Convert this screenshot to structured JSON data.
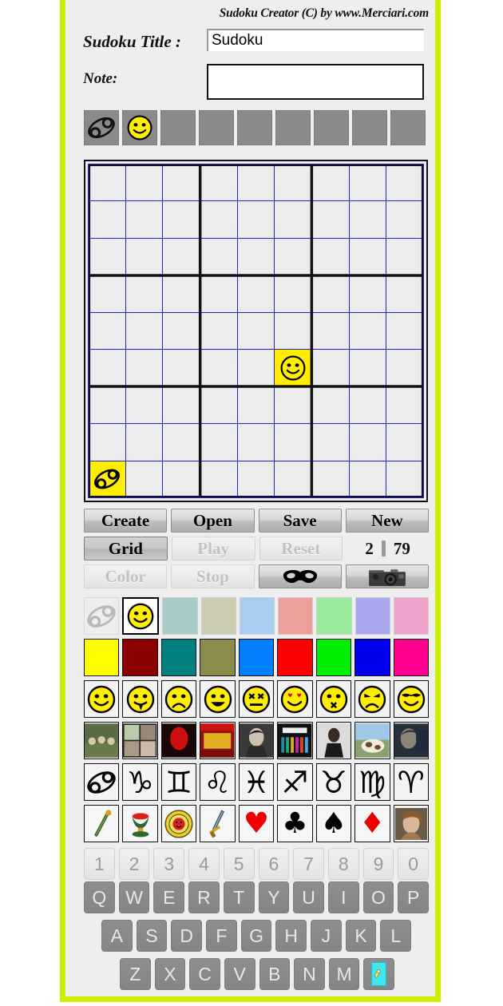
{
  "app": {
    "brand": "Sudoku Creator (C) by www.Merciari.com",
    "border_color": "#cdee00",
    "background": "#eeeeee"
  },
  "form": {
    "title_label": "Sudoku Title :",
    "title_value": "Sudoku",
    "title_placeholder": "",
    "note_label": "Note:",
    "note_value": "",
    "note_placeholder": ""
  },
  "slots": {
    "count": 9,
    "items": [
      {
        "name": "slot-cancer",
        "icon": "cancer-zodiac-icon",
        "filled": true
      },
      {
        "name": "slot-smiley",
        "icon": "smiley-happy-icon",
        "filled": true
      },
      {
        "name": "slot-3",
        "icon": "empty",
        "filled": false
      },
      {
        "name": "slot-4",
        "icon": "empty",
        "filled": false
      },
      {
        "name": "slot-5",
        "icon": "empty",
        "filled": false
      },
      {
        "name": "slot-6",
        "icon": "empty",
        "filled": false
      },
      {
        "name": "slot-7",
        "icon": "empty",
        "filled": false
      },
      {
        "name": "slot-8",
        "icon": "empty",
        "filled": false
      },
      {
        "name": "slot-9",
        "icon": "empty",
        "filled": false
      }
    ]
  },
  "grid": {
    "size": 9,
    "cell_background": "#ececec",
    "filled_background": "#ffee00",
    "thin_line_color": "#2222cc",
    "thick_line_color": "#111111",
    "filled_cells": [
      {
        "row": 6,
        "col": 6,
        "icon": "smiley-happy-icon"
      },
      {
        "row": 9,
        "col": 1,
        "icon": "cancer-zodiac-icon"
      }
    ]
  },
  "buttons": {
    "row_a": [
      {
        "label": "Create",
        "state": "normal",
        "name": "create-button"
      },
      {
        "label": "Open",
        "state": "normal",
        "name": "open-button"
      },
      {
        "label": "Save",
        "state": "normal",
        "name": "save-button"
      },
      {
        "label": "New",
        "state": "normal",
        "name": "new-button"
      }
    ],
    "row_b": [
      {
        "label": "Grid",
        "state": "pressed",
        "name": "grid-button"
      },
      {
        "label": "Play",
        "state": "disabled",
        "name": "play-button"
      },
      {
        "label": "Reset",
        "state": "disabled",
        "name": "reset-button"
      }
    ],
    "row_c": [
      {
        "label": "Color",
        "state": "disabled",
        "name": "color-button"
      },
      {
        "label": "Stop",
        "state": "disabled",
        "name": "stop-button"
      },
      {
        "label": "",
        "state": "normal",
        "name": "mask-button",
        "icon": "mask-icon"
      },
      {
        "label": "",
        "state": "normal",
        "name": "camera-button",
        "icon": "camera-icon"
      }
    ],
    "counter": {
      "filled": "2",
      "remaining": "79"
    }
  },
  "palettes": {
    "pastel": {
      "name": "pastel-color-row",
      "cells": [
        {
          "kind": "icon",
          "icon": "cancer-zodiac-icon",
          "state": "faded",
          "color": "#eeeeee"
        },
        {
          "kind": "icon",
          "icon": "smiley-happy-icon",
          "state": "selected",
          "color": "#ffffff"
        },
        {
          "kind": "color",
          "color": "#a8cccb"
        },
        {
          "kind": "color",
          "color": "#ccccb0"
        },
        {
          "kind": "color",
          "color": "#a7cdf0"
        },
        {
          "kind": "color",
          "color": "#ef9f9b"
        },
        {
          "kind": "color",
          "color": "#9ceb9a"
        },
        {
          "kind": "color",
          "color": "#a8a8f0"
        },
        {
          "kind": "color",
          "color": "#efa3cb"
        }
      ]
    },
    "bold": {
      "name": "bold-color-row",
      "cells": [
        {
          "kind": "color",
          "color": "#ffff00"
        },
        {
          "kind": "color",
          "color": "#8b0000"
        },
        {
          "kind": "color",
          "color": "#008080"
        },
        {
          "kind": "color",
          "color": "#8b8b4b"
        },
        {
          "kind": "color",
          "color": "#0080ff"
        },
        {
          "kind": "color",
          "color": "#ff0000"
        },
        {
          "kind": "color",
          "color": "#00ee00"
        },
        {
          "kind": "color",
          "color": "#0000ee"
        },
        {
          "kind": "color",
          "color": "#ff0090"
        }
      ]
    },
    "smileys": {
      "name": "smiley-row",
      "cells": [
        {
          "icon": "smiley-happy-icon"
        },
        {
          "icon": "smiley-tongue-icon"
        },
        {
          "icon": "smiley-sad-icon"
        },
        {
          "icon": "smiley-laugh-icon"
        },
        {
          "icon": "smiley-dead-icon"
        },
        {
          "icon": "smiley-love-icon"
        },
        {
          "icon": "smiley-kiss-icon"
        },
        {
          "icon": "smiley-angry-icon"
        },
        {
          "icon": "smiley-cool-icon"
        }
      ]
    },
    "albums": {
      "name": "album-cover-row",
      "cells": [
        {
          "icon": "album-band-photo-icon",
          "color": "#5b6b4a"
        },
        {
          "icon": "album-portraits-icon",
          "color": "#2a2a2a"
        },
        {
          "icon": "album-red-face-icon",
          "color": "#1a0606"
        },
        {
          "icon": "album-doors-icon",
          "color": "#8e1010"
        },
        {
          "icon": "album-elvis-icon",
          "color": "#3a3a3a"
        },
        {
          "icon": "album-beatles-icon",
          "color": "#101010"
        },
        {
          "icon": "album-michael-icon",
          "color": "#d8d8d8"
        },
        {
          "icon": "album-cow-icon",
          "color": "#89a26e"
        },
        {
          "icon": "album-dylan-icon",
          "color": "#26303c"
        }
      ]
    },
    "zodiac": {
      "name": "zodiac-row",
      "cells": [
        {
          "icon": "cancer-zodiac-icon",
          "glyph": "♋"
        },
        {
          "icon": "capricorn-zodiac-icon",
          "glyph": "♑"
        },
        {
          "icon": "gemini-zodiac-icon",
          "glyph": "♊"
        },
        {
          "icon": "leo-zodiac-icon",
          "glyph": "♌"
        },
        {
          "icon": "pisces-zodiac-icon",
          "glyph": "♓"
        },
        {
          "icon": "sagittarius-zodiac-icon",
          "glyph": "♐"
        },
        {
          "icon": "taurus-zodiac-icon",
          "glyph": "♉"
        },
        {
          "icon": "virgo-zodiac-icon",
          "glyph": "♍"
        },
        {
          "icon": "aries-zodiac-icon",
          "glyph": "♈"
        }
      ]
    },
    "suits": {
      "name": "suits-row",
      "cells": [
        {
          "icon": "tarot-wand-icon"
        },
        {
          "icon": "tarot-cup-icon"
        },
        {
          "icon": "tarot-pentacle-icon"
        },
        {
          "icon": "tarot-sword-icon"
        },
        {
          "icon": "hearts-suit-icon",
          "glyph": "♥",
          "color": "#ee0000"
        },
        {
          "icon": "clubs-suit-icon",
          "glyph": "♣",
          "color": "#000000"
        },
        {
          "icon": "spades-suit-icon",
          "glyph": "♠",
          "color": "#000000"
        },
        {
          "icon": "diamonds-suit-icon",
          "glyph": "♦",
          "color": "#ee0000"
        },
        {
          "icon": "portrait-face-icon",
          "color": "#8a6a52"
        }
      ]
    }
  },
  "keyboard": {
    "numbers": [
      "1",
      "2",
      "3",
      "4",
      "5",
      "6",
      "7",
      "8",
      "9",
      "0"
    ],
    "row_q": [
      "Q",
      "W",
      "E",
      "R",
      "T",
      "Y",
      "U",
      "I",
      "O",
      "P"
    ],
    "row_a": [
      "A",
      "S",
      "D",
      "F",
      "G",
      "H",
      "J",
      "K",
      "L"
    ],
    "row_z": [
      "Z",
      "X",
      "C",
      "V",
      "B",
      "N",
      "M"
    ],
    "eraser_icon": "eraser-pencil-icon"
  }
}
